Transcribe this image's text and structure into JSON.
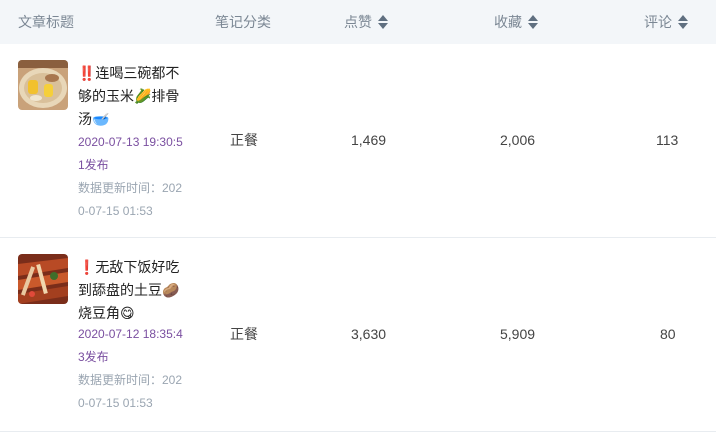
{
  "columns": {
    "title": "文章标题",
    "category": "笔记分类",
    "likes": "点赞",
    "favorites": "收藏",
    "comments": "评论"
  },
  "rows": [
    {
      "title": "‼️连喝三碗都不够的玉米🌽排骨汤🥣",
      "published": "2020-07-13 19:30:51发布",
      "updated": "数据更新时间：2020-07-15 01:53",
      "category": "正餐",
      "likes": "1,469",
      "favorites": "2,006",
      "comments": "113"
    },
    {
      "title": "❗无敌下饭好吃到舔盘的土豆🥔烧豆角😋",
      "published": "2020-07-12 18:35:43发布",
      "updated": "数据更新时间：2020-07-15 01:53",
      "category": "正餐",
      "likes": "3,630",
      "favorites": "5,909",
      "comments": "80"
    }
  ],
  "icons": {
    "sort": "sort-caret-icon"
  },
  "colors": {
    "header_bg": "#f3f6f9",
    "publish_text": "#7a4fa0",
    "update_text": "#9aa5b1"
  }
}
